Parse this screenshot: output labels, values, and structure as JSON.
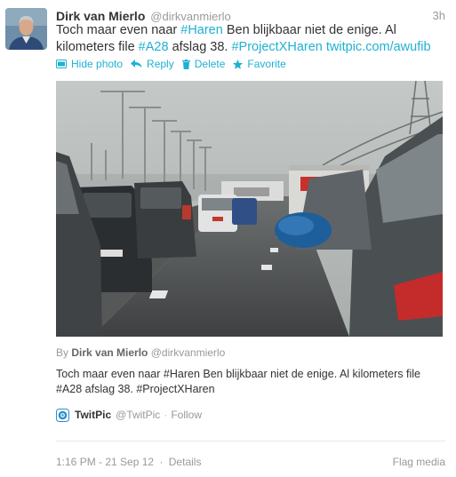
{
  "tweet": {
    "fullname": "Dirk van Mierlo",
    "username": "@dirkvanmierlo",
    "time": "3h",
    "text": {
      "part1": "Toch maar even naar ",
      "hashtag1": "#Haren",
      "part2": " Ben blijkbaar niet de enige. Al kilometers file ",
      "hashtag2": "#A28",
      "part3": " afslag 38. ",
      "hashtag3": "#ProjectXHaren",
      "space": " ",
      "link": "twitpic.com/awufib"
    },
    "actions": {
      "hide_photo": "Hide photo",
      "reply": "Reply",
      "delete": "Delete",
      "favorite": "Favorite"
    }
  },
  "media": {
    "byline_prefix": "By",
    "author_name": "Dirk van Mierlo",
    "author_handle": "@dirkvanmierlo",
    "caption": "Toch maar even naar #Haren Ben blijkbaar niet de enige. Al kilometers file #A28 afslag 38. #ProjectXHaren",
    "source_name": "TwitPic",
    "source_handle": "@TwitPic",
    "source_separator": "·",
    "follow": "Follow"
  },
  "footer": {
    "timestamp": "1:16 PM - 21 Sep 12",
    "separator": "·",
    "details": "Details",
    "flag_media": "Flag media"
  },
  "colors": {
    "link_accent": "#1fb1d3",
    "muted_text": "#999999",
    "body_text": "#333333"
  },
  "icons": {
    "hide_photo": "photo-icon",
    "reply": "reply-arrow-icon",
    "delete": "trash-icon",
    "favorite": "star-icon",
    "source": "twitpic-logo-icon"
  }
}
